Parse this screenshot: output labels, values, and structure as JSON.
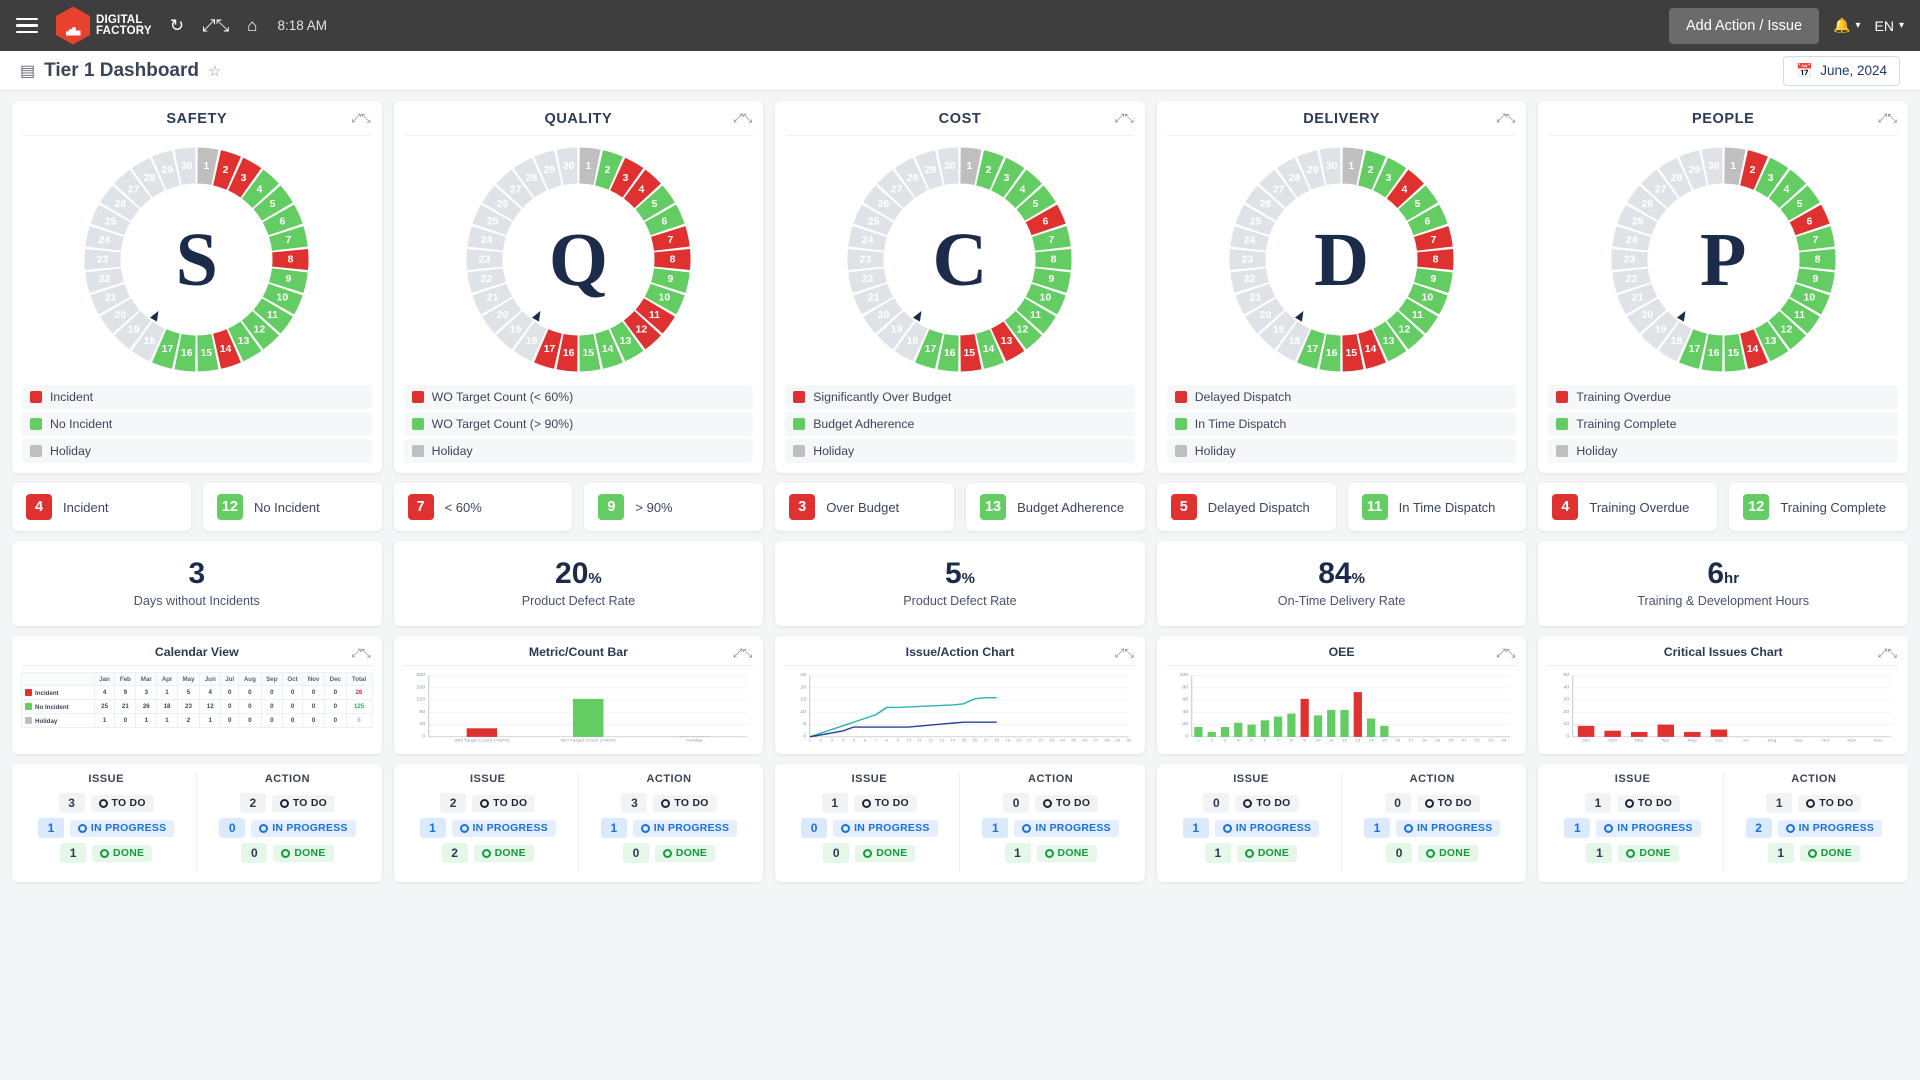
{
  "topbar": {
    "menu_icon": "hamburger-icon",
    "brand_line1": "DIGITAL",
    "brand_line2": "FACTORY",
    "refresh_icon": "refresh-icon",
    "expand_icon": "fullscreen-icon",
    "home_icon": "home-icon",
    "time": "8:18 AM",
    "add_button": "Add Action / Issue",
    "bell_icon": "bell-icon",
    "language": "EN"
  },
  "header": {
    "dashboard_icon": "dashboard-icon",
    "title": "Tier 1 Dashboard",
    "star_icon": "star-icon",
    "calendar_icon": "calendar-icon",
    "date": "June, 2024"
  },
  "colors": {
    "red": "#e03131",
    "green": "#63cc63",
    "gray": "#bfbfbf",
    "holiday": "#dfe3e8",
    "navy": "#1c2b4a",
    "teal": "#28b4b4",
    "blue": "#2b3f9e"
  },
  "pillars": [
    {
      "name": "SAFETY",
      "letter": "S",
      "days": [
        "gray",
        "red",
        "red",
        "green",
        "green",
        "green",
        "green",
        "red",
        "green",
        "green",
        "green",
        "green",
        "green",
        "red",
        "green",
        "green",
        "green",
        "holiday",
        "holiday",
        "holiday",
        "holiday",
        "holiday",
        "holiday",
        "holiday",
        "holiday",
        "holiday",
        "holiday",
        "holiday",
        "holiday",
        "holiday"
      ],
      "legend": [
        {
          "label": "Incident",
          "color": "#e03131"
        },
        {
          "label": "No Incident",
          "color": "#63cc63"
        },
        {
          "label": "Holiday",
          "color": "#bfbfbf"
        }
      ],
      "kpis": [
        {
          "value": "4",
          "label": "Incident",
          "color": "#e03131"
        },
        {
          "value": "12",
          "label": "No Incident",
          "color": "#63cc63"
        }
      ],
      "metric": {
        "value": "3",
        "unit": "",
        "label": "Days without Incidents"
      },
      "chart_title": "Calendar View"
    },
    {
      "name": "QUALITY",
      "letter": "Q",
      "days": [
        "gray",
        "green",
        "red",
        "red",
        "green",
        "green",
        "red",
        "red",
        "green",
        "green",
        "red",
        "red",
        "green",
        "green",
        "green",
        "red",
        "red",
        "holiday",
        "holiday",
        "holiday",
        "holiday",
        "holiday",
        "holiday",
        "holiday",
        "holiday",
        "holiday",
        "holiday",
        "holiday",
        "holiday",
        "holiday"
      ],
      "legend": [
        {
          "label": "WO Target Count (< 60%)",
          "color": "#e03131"
        },
        {
          "label": "WO Target Count (> 90%)",
          "color": "#63cc63"
        },
        {
          "label": "Holiday",
          "color": "#bfbfbf"
        }
      ],
      "kpis": [
        {
          "value": "7",
          "label": "< 60%",
          "color": "#e03131"
        },
        {
          "value": "9",
          "label": "> 90%",
          "color": "#63cc63"
        }
      ],
      "metric": {
        "value": "20",
        "unit": "%",
        "label": "Product Defect Rate"
      },
      "chart_title": "Metric/Count Bar"
    },
    {
      "name": "COST",
      "letter": "C",
      "days": [
        "gray",
        "green",
        "green",
        "green",
        "green",
        "red",
        "green",
        "green",
        "green",
        "green",
        "green",
        "green",
        "red",
        "green",
        "red",
        "green",
        "green",
        "holiday",
        "holiday",
        "holiday",
        "holiday",
        "holiday",
        "holiday",
        "holiday",
        "holiday",
        "holiday",
        "holiday",
        "holiday",
        "holiday",
        "holiday"
      ],
      "legend": [
        {
          "label": "Significantly Over Budget",
          "color": "#e03131"
        },
        {
          "label": "Budget Adherence",
          "color": "#63cc63"
        },
        {
          "label": "Holiday",
          "color": "#bfbfbf"
        }
      ],
      "kpis": [
        {
          "value": "3",
          "label": "Over Budget",
          "color": "#e03131"
        },
        {
          "value": "13",
          "label": "Budget Adherence",
          "color": "#63cc63"
        }
      ],
      "metric": {
        "value": "5",
        "unit": "%",
        "label": "Product Defect Rate"
      },
      "chart_title": "Issue/Action Chart"
    },
    {
      "name": "DELIVERY",
      "letter": "D",
      "days": [
        "gray",
        "green",
        "green",
        "red",
        "green",
        "green",
        "red",
        "red",
        "green",
        "green",
        "green",
        "green",
        "green",
        "red",
        "red",
        "green",
        "green",
        "holiday",
        "holiday",
        "holiday",
        "holiday",
        "holiday",
        "holiday",
        "holiday",
        "holiday",
        "holiday",
        "holiday",
        "holiday",
        "holiday",
        "holiday"
      ],
      "legend": [
        {
          "label": "Delayed Dispatch",
          "color": "#e03131"
        },
        {
          "label": "In Time Dispatch",
          "color": "#63cc63"
        },
        {
          "label": "Holiday",
          "color": "#bfbfbf"
        }
      ],
      "kpis": [
        {
          "value": "5",
          "label": "Delayed Dispatch",
          "color": "#e03131"
        },
        {
          "value": "11",
          "label": "In Time Dispatch",
          "color": "#63cc63"
        }
      ],
      "metric": {
        "value": "84",
        "unit": "%",
        "label": "On-Time Delivery Rate"
      },
      "chart_title": "OEE"
    },
    {
      "name": "PEOPLE",
      "letter": "P",
      "days": [
        "gray",
        "red",
        "green",
        "green",
        "green",
        "red",
        "green",
        "green",
        "green",
        "green",
        "green",
        "green",
        "green",
        "red",
        "green",
        "green",
        "green",
        "holiday",
        "holiday",
        "holiday",
        "holiday",
        "holiday",
        "holiday",
        "holiday",
        "holiday",
        "holiday",
        "holiday",
        "holiday",
        "holiday",
        "holiday"
      ],
      "legend": [
        {
          "label": "Training Overdue",
          "color": "#e03131"
        },
        {
          "label": "Training Complete",
          "color": "#63cc63"
        },
        {
          "label": "Holiday",
          "color": "#bfbfbf"
        }
      ],
      "kpis": [
        {
          "value": "4",
          "label": "Training Overdue",
          "color": "#e03131"
        },
        {
          "value": "12",
          "label": "Training Complete",
          "color": "#63cc63"
        }
      ],
      "metric": {
        "value": "6",
        "unit": "hr",
        "label": "Training & Development Hours"
      },
      "chart_title": "Critical Issues Chart"
    }
  ],
  "calendar_table": {
    "months": [
      "Jan",
      "Feb",
      "Mar",
      "Apr",
      "May",
      "Jun",
      "Jul",
      "Aug",
      "Sep",
      "Oct",
      "Nov",
      "Dec"
    ],
    "total_header": "Total",
    "rows": [
      {
        "label": "Incident",
        "color": "#e03131",
        "values": [
          4,
          9,
          3,
          1,
          5,
          4,
          0,
          0,
          0,
          0,
          0,
          0
        ],
        "total": 26,
        "total_class": "tot-red"
      },
      {
        "label": "No Incident",
        "color": "#63cc63",
        "values": [
          25,
          21,
          26,
          18,
          23,
          12,
          0,
          0,
          0,
          0,
          0,
          0
        ],
        "total": 125,
        "total_class": "tot-green"
      },
      {
        "label": "Holiday",
        "color": "#bfbfbf",
        "values": [
          1,
          0,
          1,
          1,
          2,
          1,
          0,
          0,
          0,
          0,
          0,
          0
        ],
        "total": 6,
        "total_class": "tot-gray"
      }
    ]
  },
  "chart_data": [
    {
      "type": "bar",
      "title": "Metric/Count Bar",
      "categories": [
        "WO Target Count (<60%)",
        "WO Target Count (>90%)",
        "Holiday"
      ],
      "values": [
        28,
        124,
        2
      ],
      "colors": [
        "#e03131",
        "#63cc63",
        "#bfbfbf"
      ],
      "ylabel": "",
      "xlabel": "",
      "ylim": [
        0,
        200
      ],
      "yticks": [
        0,
        40,
        80,
        120,
        160,
        200
      ],
      "grid": true
    },
    {
      "type": "line",
      "title": "Issue/Action Chart",
      "x": [
        1,
        2,
        3,
        4,
        5,
        6,
        7,
        8,
        9,
        10,
        11,
        12,
        13,
        14,
        15,
        16,
        17,
        18,
        19,
        20,
        21,
        22,
        23,
        24,
        25,
        26,
        27,
        28,
        29,
        30
      ],
      "ylim": [
        0,
        25
      ],
      "yticks": [
        0,
        5,
        10,
        15,
        20,
        25
      ],
      "grid": true,
      "series": [
        {
          "name": "Issue",
          "color": "#28b4b4",
          "values": [
            0,
            1.5,
            3,
            4.5,
            6,
            7.5,
            9,
            12,
            12,
            12.2,
            12.4,
            12.6,
            12.8,
            13,
            13.5,
            15.5,
            16,
            16,
            null,
            null,
            null,
            null,
            null,
            null,
            null,
            null,
            null,
            null,
            null,
            null
          ]
        },
        {
          "name": "Action",
          "color": "#2b3f9e",
          "values": [
            0,
            0.8,
            1.6,
            2.4,
            4,
            4,
            4,
            4,
            4,
            4,
            4.4,
            4.8,
            5.2,
            5.6,
            6,
            6,
            6,
            6,
            null,
            null,
            null,
            null,
            null,
            null,
            null,
            null,
            null,
            null,
            null,
            null
          ]
        }
      ]
    },
    {
      "type": "bar",
      "title": "OEE",
      "categories": [
        1,
        2,
        3,
        4,
        5,
        6,
        7,
        8,
        9,
        10,
        11,
        12,
        13,
        14,
        15,
        16,
        17,
        18,
        19,
        20,
        21,
        22,
        23,
        24
      ],
      "values": [
        16,
        8,
        16,
        23,
        20,
        27,
        33,
        38,
        62,
        35,
        44,
        44,
        73,
        30,
        18,
        0,
        0,
        0,
        0,
        0,
        0,
        0,
        0,
        0
      ],
      "colors": [
        "#63cc63",
        "#63cc63",
        "#63cc63",
        "#63cc63",
        "#63cc63",
        "#63cc63",
        "#63cc63",
        "#63cc63",
        "#e03131",
        "#63cc63",
        "#63cc63",
        "#63cc63",
        "#e03131",
        "#63cc63",
        "#63cc63",
        "#63cc63",
        "#63cc63",
        "#63cc63",
        "#63cc63",
        "#63cc63",
        "#63cc63",
        "#63cc63",
        "#63cc63",
        "#63cc63"
      ],
      "ylim": [
        0,
        100
      ],
      "yticks": [
        0,
        20,
        40,
        60,
        80,
        100
      ],
      "grid": true
    },
    {
      "type": "bar",
      "title": "Critical Issues Chart",
      "categories": [
        "Jan",
        "Feb",
        "Mar",
        "Apr",
        "May",
        "Jun",
        "Jul",
        "Aug",
        "Sep",
        "Oct",
        "Nov",
        "Dec"
      ],
      "values": [
        9,
        5,
        4,
        10,
        4,
        6,
        0,
        0,
        0,
        0,
        0,
        0
      ],
      "colors": [
        "#e03131",
        "#e03131",
        "#e03131",
        "#e03131",
        "#e03131",
        "#e03131",
        "#e03131",
        "#e03131",
        "#e03131",
        "#e03131",
        "#e03131",
        "#e03131"
      ],
      "ylim": [
        0,
        50
      ],
      "yticks": [
        0,
        10,
        20,
        30,
        40,
        50
      ],
      "grid": true
    }
  ],
  "issue_action": {
    "issue_header": "ISSUE",
    "action_header": "ACTION",
    "status_labels": [
      "TO DO",
      "IN PROGRESS",
      "DONE"
    ],
    "cards": [
      {
        "issue": [
          "3",
          "1",
          "1"
        ],
        "action": [
          "2",
          "0",
          "0"
        ]
      },
      {
        "issue": [
          "2",
          "1",
          "2"
        ],
        "action": [
          "3",
          "1",
          "0"
        ]
      },
      {
        "issue": [
          "1",
          "0",
          "0"
        ],
        "action": [
          "0",
          "1",
          "1"
        ]
      },
      {
        "issue": [
          "0",
          "1",
          "1"
        ],
        "action": [
          "0",
          "1",
          "0"
        ]
      },
      {
        "issue": [
          "1",
          "1",
          "1"
        ],
        "action": [
          "1",
          "2",
          "1"
        ]
      }
    ]
  }
}
